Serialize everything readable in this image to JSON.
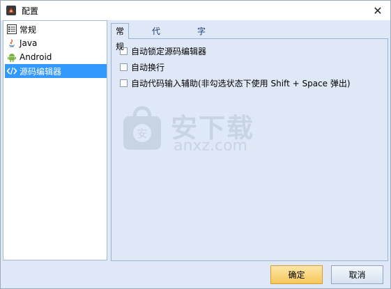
{
  "window": {
    "title": "配置",
    "close_label": "✕",
    "title_icon": "app-icon"
  },
  "tree": {
    "items": [
      {
        "label": "常规",
        "icon": "general-settings-icon"
      },
      {
        "label": "Java",
        "icon": "java-icon"
      },
      {
        "label": "Android",
        "icon": "android-icon"
      },
      {
        "label": "源码编辑器",
        "icon": "code-brackets-icon",
        "selected": true
      }
    ]
  },
  "tabs": [
    {
      "label": "常规",
      "active": true
    },
    {
      "label": "代码着色",
      "active": false
    },
    {
      "label": "字体",
      "active": false
    }
  ],
  "options": [
    {
      "label": "自动锁定源码编辑器",
      "checked": false
    },
    {
      "label": "自动换行",
      "checked": false
    },
    {
      "label": "自动代码输入辅助(非勾选状态下使用 Shift + Space 弹出)",
      "checked": false
    }
  ],
  "watermark": {
    "big": "安下载",
    "small": "anxz.com",
    "bag_char": "安"
  },
  "buttons": {
    "ok": "确定",
    "cancel": "取消"
  },
  "colors": {
    "selection": "#3399ff",
    "background": "#dfe8f6",
    "ok_button": "#f6c65b"
  }
}
